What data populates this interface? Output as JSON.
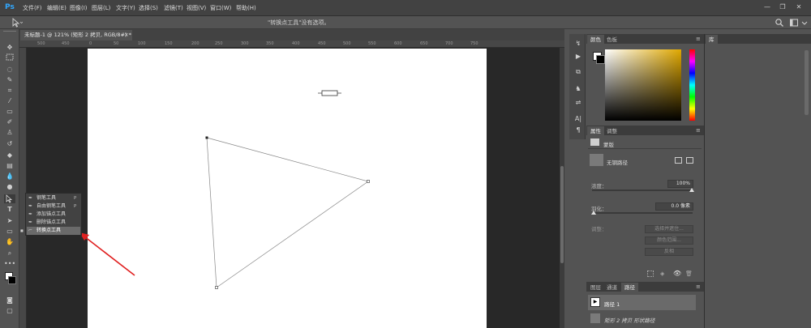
{
  "app": {
    "logo": "Ps"
  },
  "menubar": {
    "items": [
      "文件(F)",
      "编辑(E)",
      "图像(I)",
      "图层(L)",
      "文字(Y)",
      "选择(S)",
      "滤镜(T)",
      "视图(V)",
      "窗口(W)",
      "帮助(H)"
    ],
    "window_controls": [
      "—",
      "❐",
      "✕"
    ]
  },
  "options_bar": {
    "tool_icon": "pointer-icon",
    "hint": "\"转换点工具\"没有选项。",
    "right_icons": [
      "search-icon",
      "workspace-icon",
      "arrange-icon"
    ]
  },
  "document": {
    "tab_title": "未标题-1 @ 121% (矩形 2 拷贝, RGB/8#) *",
    "tab_close": "×",
    "ruler_ticks": [
      "500",
      "450",
      "0",
      "50",
      "100",
      "150",
      "200",
      "250",
      "300",
      "350",
      "400",
      "450",
      "500",
      "550",
      "600",
      "650",
      "700",
      "750"
    ]
  },
  "flyout": {
    "items": [
      {
        "label": "钢笔工具",
        "key": "P",
        "icon": "pen-icon"
      },
      {
        "label": "自由钢笔工具",
        "key": "P",
        "icon": "freeform-pen-icon"
      },
      {
        "label": "添加锚点工具",
        "key": "",
        "icon": "add-anchor-icon"
      },
      {
        "label": "删除锚点工具",
        "key": "",
        "icon": "delete-anchor-icon"
      },
      {
        "label": "转换点工具",
        "key": "",
        "icon": "convert-point-icon",
        "selected": true
      }
    ],
    "selected_marker": "■"
  },
  "color_panel": {
    "tabs": [
      "颜色",
      "色板"
    ],
    "foreground": "#ffffff",
    "background": "#000000",
    "hue_base": "#e0a800"
  },
  "properties_panel": {
    "tabs": [
      "属性",
      "调整"
    ],
    "section": "蒙版",
    "mask_label": "无钢路径",
    "density_label": "浓度：",
    "density_value": "100%",
    "feather_label": "羽化：",
    "feather_value": "0.0 像素",
    "refine_label": "调整：",
    "buttons": [
      "选择并遮住...",
      "颜色范围...",
      "反相"
    ]
  },
  "paths_panel": {
    "tabs": [
      "图层",
      "通道",
      "路径"
    ],
    "rows": [
      "路径 1",
      "矩形 2 拷贝 形状路径"
    ]
  },
  "library_panel": {
    "title": "库"
  },
  "colors": {
    "accent": "#31a8ff",
    "arrow": "#e02020"
  }
}
